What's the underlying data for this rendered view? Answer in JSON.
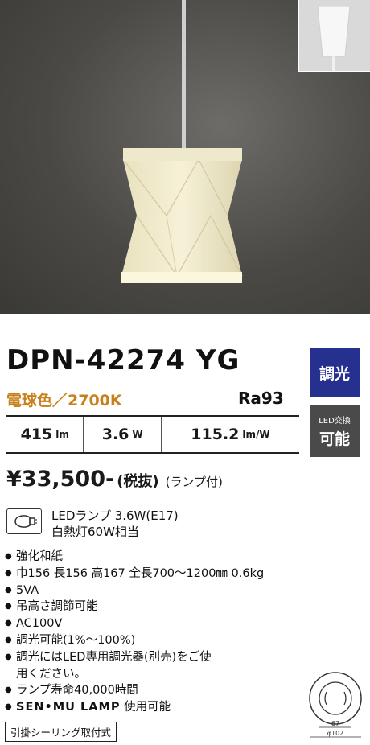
{
  "product": {
    "model": "DPN-42274 YG",
    "color_temp": "電球色／2700K",
    "ra": "Ra93"
  },
  "badges": {
    "dimmable": "調光",
    "led_replace_small": "LED交換",
    "led_replace_big": "可能"
  },
  "specs": [
    {
      "value": "415",
      "unit": "lm"
    },
    {
      "value": "3.6",
      "unit": "W"
    },
    {
      "value": "115.2",
      "unit": "lm/W"
    }
  ],
  "price": {
    "amount": "¥33,500-",
    "tax": "(税抜)",
    "lamp_note": "(ランプ付)"
  },
  "lamp": {
    "line1": "LEDランプ 3.6W(E17)",
    "line2": "白熱灯60W相当"
  },
  "features": [
    "強化和紙",
    "巾156 長156 高167 全長700～1200㎜ 0.6kg",
    "5VA",
    "吊高さ調節可能",
    "AC100V",
    "調光可能(1%～100%)",
    "調光にはLED専用調光器(別売)をご使",
    "用ください。",
    "ランプ寿命40,000時間"
  ],
  "logo_line": {
    "logo": "SEN•MU LAMP",
    "text": "使用可能"
  },
  "footer": "引掛シーリング取付式",
  "diagram": {
    "dim_inner": "67",
    "dim_outer": "φ102"
  }
}
